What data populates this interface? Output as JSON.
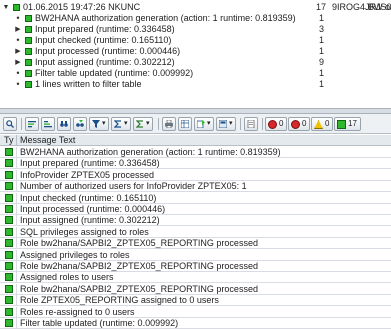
{
  "tree": {
    "rows": [
      {
        "text": "01.06.2015  19:47:26  NKUNC",
        "col1": "17",
        "col2": "9IROG4JRJS0F...",
        "col3": "BW on",
        "level": 0,
        "expander": "▼"
      },
      {
        "text": "BW2HANA authorization generation (action: 1 runtime: 0.819359)",
        "col1": "1",
        "col2": "",
        "col3": "",
        "level": 1,
        "expander": "•"
      },
      {
        "text": "Input prepared (runtime: 0.336458)",
        "col1": "3",
        "col2": "",
        "col3": "",
        "level": 1,
        "expander": "▶"
      },
      {
        "text": "Input checked (runtime: 0.165110)",
        "col1": "1",
        "col2": "",
        "col3": "",
        "level": 1,
        "expander": "•"
      },
      {
        "text": "Input processed (runtime: 0.000446)",
        "col1": "1",
        "col2": "",
        "col3": "",
        "level": 1,
        "expander": "▶"
      },
      {
        "text": "Input assigned (runtime: 0.302212)",
        "col1": "9",
        "col2": "",
        "col3": "",
        "level": 1,
        "expander": "▶"
      },
      {
        "text": "Filter table updated (runtime: 0.009992)",
        "col1": "1",
        "col2": "",
        "col3": "",
        "level": 1,
        "expander": "•"
      },
      {
        "text": "1 lines written to filter table",
        "col1": "1",
        "col2": "",
        "col3": "",
        "level": 1,
        "expander": "•"
      }
    ]
  },
  "toolbar": {
    "badges": [
      {
        "count": "0",
        "color": "#d62828",
        "name": "errors-filter"
      },
      {
        "count": "0",
        "color": "#d62828",
        "name": "stop-filter"
      },
      {
        "count": "0",
        "color": "#f2c200",
        "name": "warnings-filter"
      },
      {
        "count": "17",
        "color": "#2eb82e",
        "name": "success-filter"
      }
    ]
  },
  "grid": {
    "header": {
      "ty": "Ty",
      "message": "Message Text"
    },
    "rows": [
      "BW2HANA authorization generation (action: 1 runtime: 0.819359)",
      "Input prepared (runtime: 0.336458)",
      "InfoProvider ZPTEX05 processed",
      "Number of authorized users for InfoProvider ZPTEX05: 1",
      "Input checked (runtime: 0.165110)",
      "Input processed (runtime: 0.000446)",
      "Input assigned (runtime: 0.302212)",
      "SQL privileges assigned to roles",
      "Role bw2hana/SAPBI2_ZPTEX05_REPORTING processed",
      "Assigned privileges to roles",
      "Role bw2hana/SAPBI2_ZPTEX05_REPORTING processed",
      "Assigned roles to users",
      "Role bw2hana/SAPBI2_ZPTEX05_REPORTING processed",
      "Role ZPTEX05_REPORTING assigned to 0 users",
      "Roles re-assigned to 0 users",
      "Filter table updated (runtime: 0.009992)"
    ]
  },
  "colors": {
    "success": "#2eb82e",
    "error": "#d62828",
    "warning": "#f2c200"
  }
}
